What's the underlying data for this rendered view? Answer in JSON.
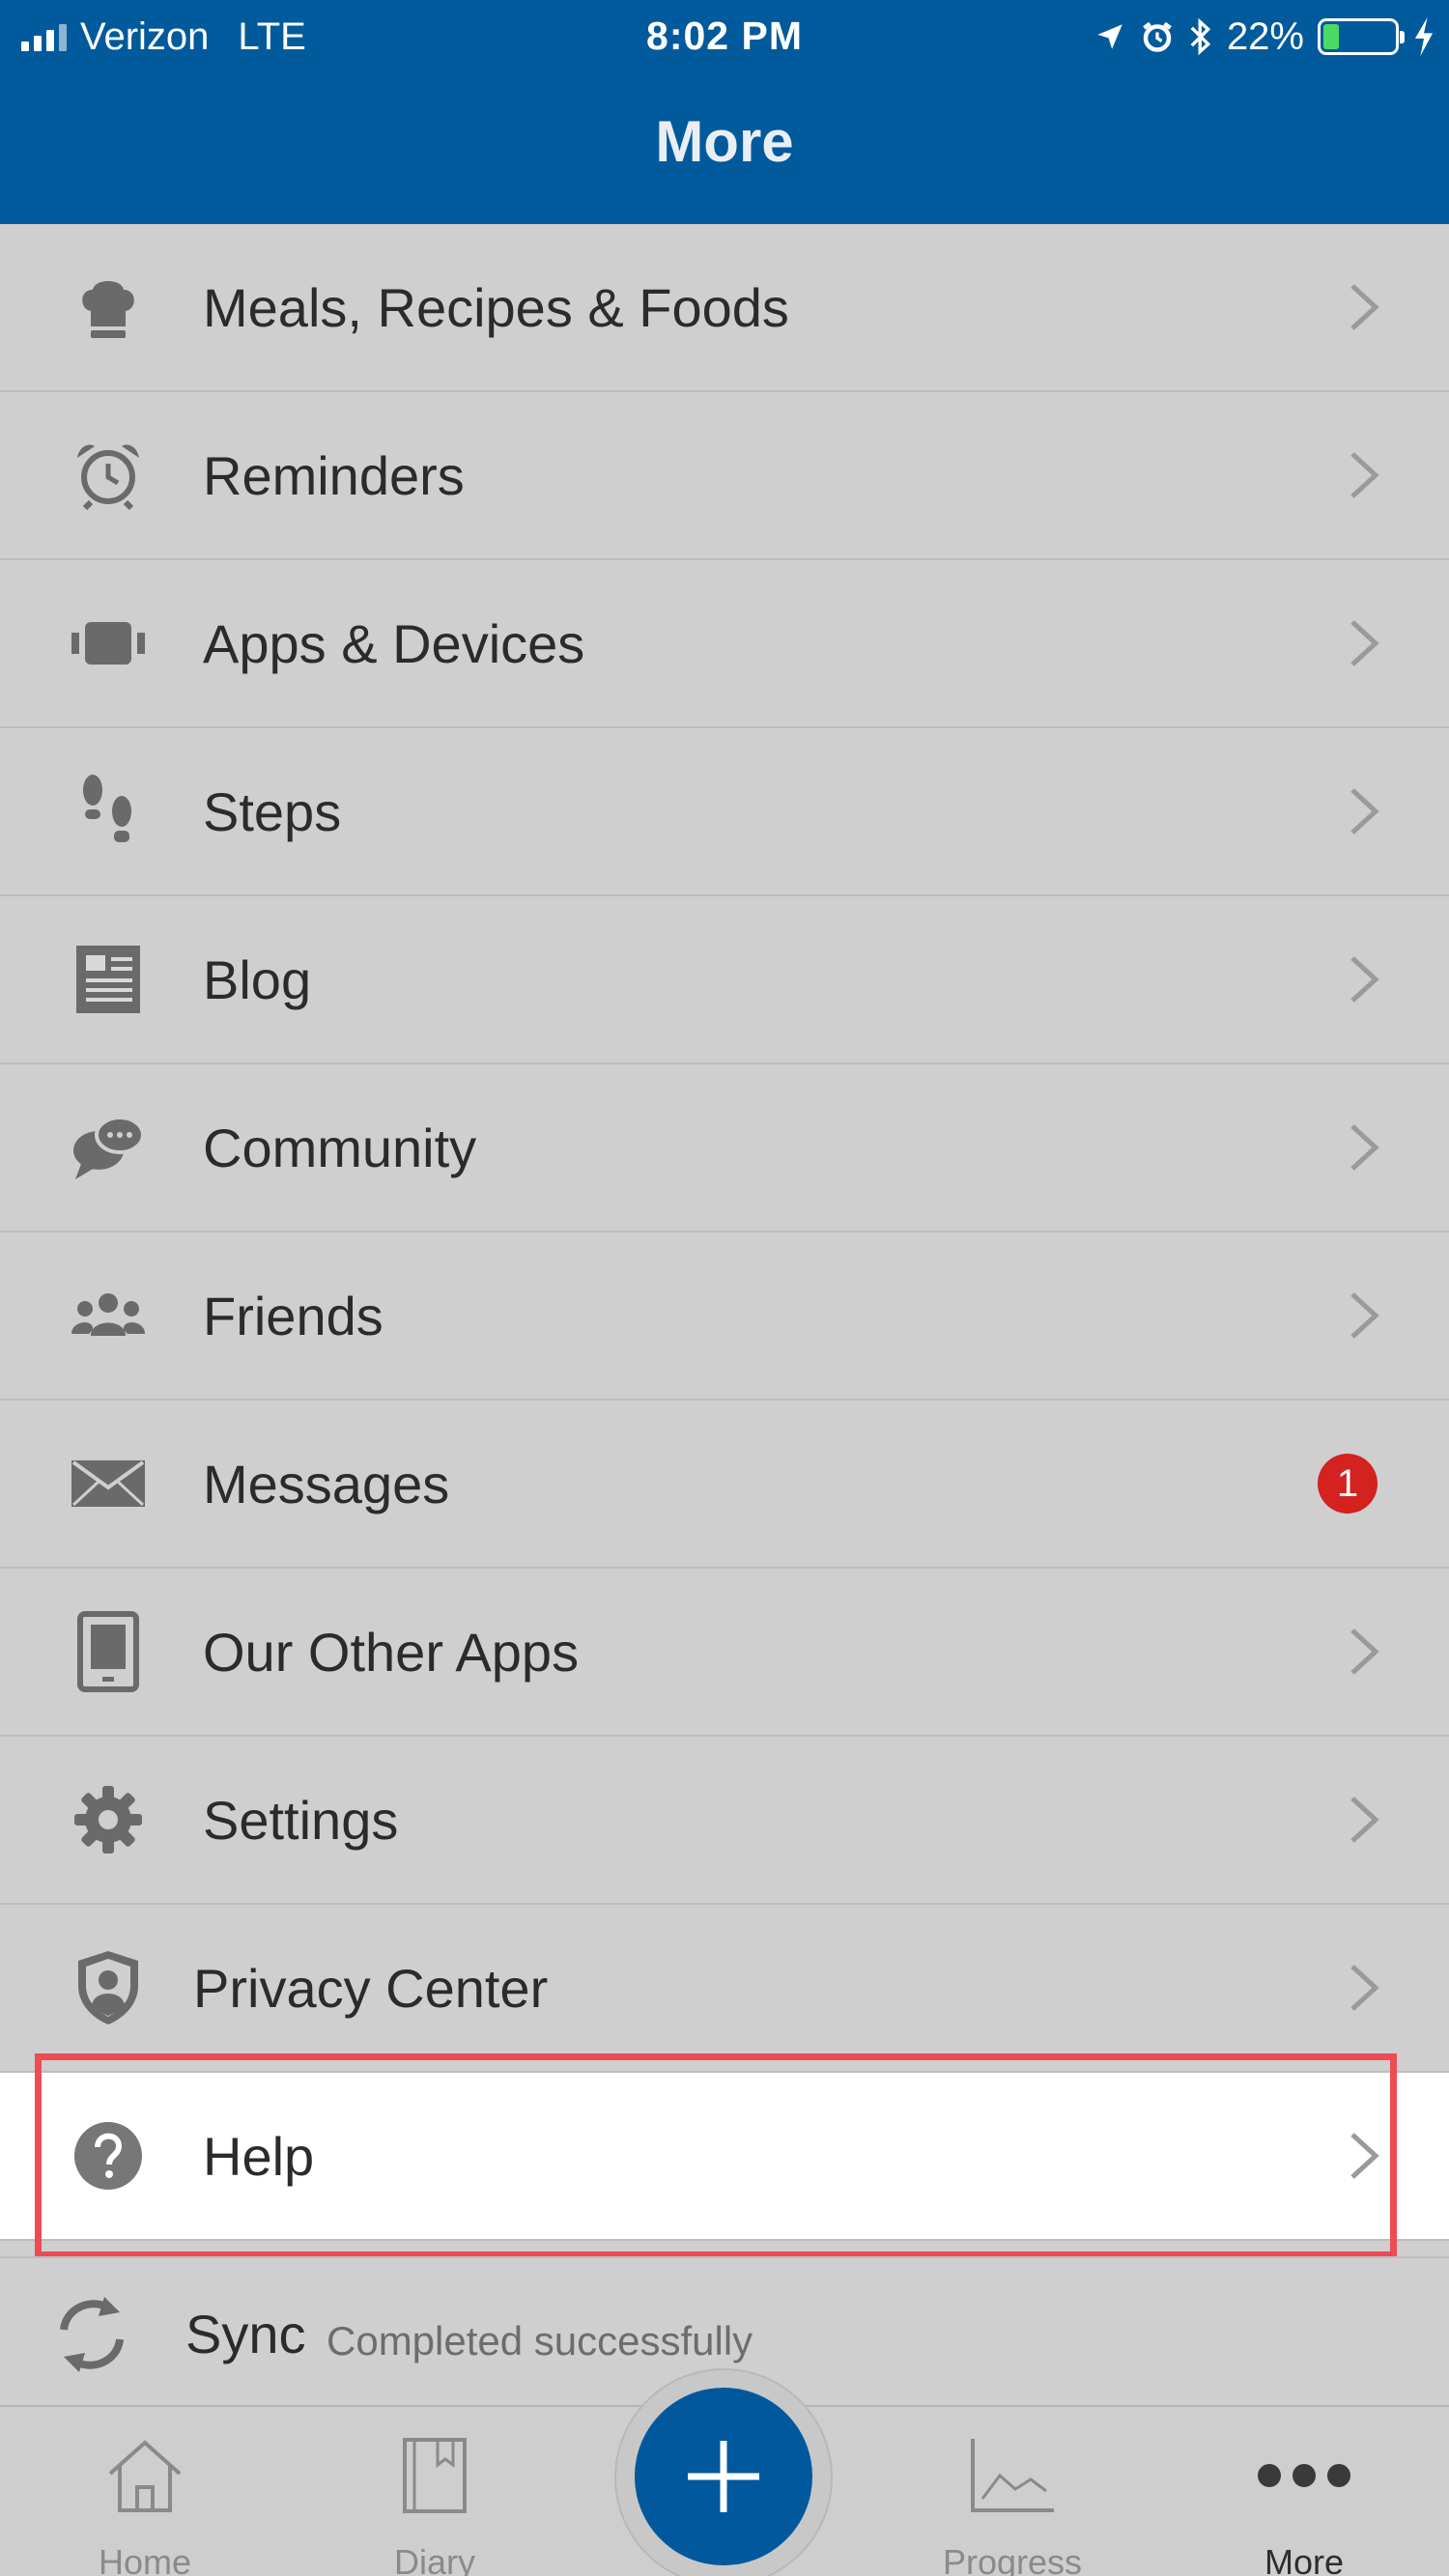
{
  "status_bar": {
    "carrier": "Verizon",
    "network": "LTE",
    "time": "8:02 PM",
    "battery_percent": "22%",
    "battery_level": 0.22,
    "icons": [
      "location-icon",
      "alarm-icon",
      "bluetooth-icon",
      "charging-icon"
    ]
  },
  "header": {
    "title": "More"
  },
  "menu": {
    "items": [
      {
        "label": "Meals, Recipes & Foods",
        "icon": "chef-hat-icon"
      },
      {
        "label": "Reminders",
        "icon": "alarm-clock-icon"
      },
      {
        "label": "Apps & Devices",
        "icon": "wristband-icon"
      },
      {
        "label": "Steps",
        "icon": "footprints-icon"
      },
      {
        "label": "Blog",
        "icon": "newspaper-icon"
      },
      {
        "label": "Community",
        "icon": "chat-bubbles-icon"
      },
      {
        "label": "Friends",
        "icon": "people-icon"
      },
      {
        "label": "Messages",
        "icon": "envelope-icon",
        "badge": "1"
      },
      {
        "label": "Our Other Apps",
        "icon": "tablet-icon"
      },
      {
        "label": "Settings",
        "icon": "gear-icon"
      },
      {
        "label": "Privacy Center",
        "icon": "shield-user-icon"
      },
      {
        "label": "Help",
        "icon": "question-circle-icon",
        "highlighted": true
      }
    ]
  },
  "sync": {
    "label": "Sync",
    "status": "Completed successfully",
    "icon": "sync-icon"
  },
  "tab_bar": {
    "tabs": [
      {
        "label": "Home",
        "icon": "home-icon"
      },
      {
        "label": "Diary",
        "icon": "book-icon"
      },
      {
        "label": "Progress",
        "icon": "chart-line-icon"
      },
      {
        "label": "More",
        "icon": "more-dots-icon",
        "active": true
      }
    ],
    "add_button_icon": "plus-icon"
  },
  "colors": {
    "header_bg": "#015a9c",
    "list_bg": "#cfcfcf",
    "highlight_border": "#ee4b52",
    "badge": "#d32220",
    "fab": "#01589c"
  }
}
